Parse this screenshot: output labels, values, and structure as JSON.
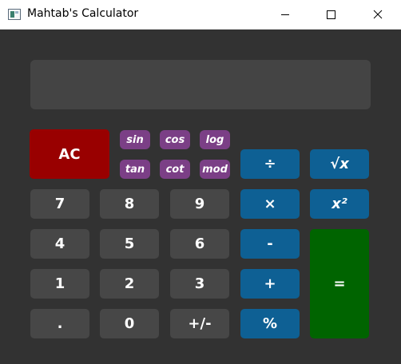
{
  "window": {
    "title": "Mahtab's Calculator",
    "icon": "app-window-icon"
  },
  "display": {
    "value": ""
  },
  "buttons": {
    "ac": "AC",
    "sin": "sin",
    "cos": "cos",
    "log": "log",
    "tan": "tan",
    "cot": "cot",
    "mod": "mod",
    "divide": "÷",
    "sqrt": "√x",
    "seven": "7",
    "eight": "8",
    "nine": "9",
    "multiply": "×",
    "square": "x²",
    "four": "4",
    "five": "5",
    "six": "6",
    "minus": "-",
    "equals": "=",
    "one": "1",
    "two": "2",
    "three": "3",
    "plus": "+",
    "dot": ".",
    "zero": "0",
    "sign": "+/-",
    "percent": "%"
  },
  "colors": {
    "background": "#323232",
    "display": "#444444",
    "number_button": "#474747",
    "operator_button": "#0e6094",
    "function_button": "#7b3f86",
    "clear_button": "#990000",
    "equals_button": "#006400"
  }
}
